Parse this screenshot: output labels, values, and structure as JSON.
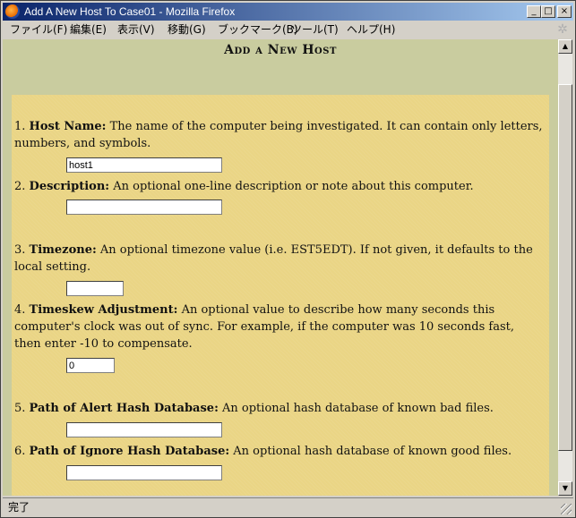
{
  "window": {
    "title": "Add A New Host To Case01 - Mozilla Firefox",
    "controls": {
      "minimize": "_",
      "maximize": "□",
      "close": "×"
    }
  },
  "menu": {
    "items": [
      "ファイル(F)",
      "編集(E)",
      "表示(V)",
      "移動(G)",
      "ブックマーク(B)",
      "ツール(T)",
      "ヘルプ(H)"
    ]
  },
  "page": {
    "heading": "Add a New Host",
    "fields": [
      {
        "number": "1.",
        "label": "Host Name:",
        "description": "The name of the computer being investigated. It can contain only letters, numbers, and symbols.",
        "value": "host1"
      },
      {
        "number": "2.",
        "label": "Description:",
        "description": "An optional one-line description or note about this computer.",
        "value": ""
      },
      {
        "number": "3.",
        "label": "Timezone:",
        "description": "An optional timezone value (i.e. EST5EDT). If not given, it defaults to the local setting.",
        "value": ""
      },
      {
        "number": "4.",
        "label": "Timeskew Adjustment:",
        "description": "An optional value to describe how many seconds this computer's clock was out of sync. For example, if the computer was 10 seconds fast, then enter -10 to compensate.",
        "value": "0"
      },
      {
        "number": "5.",
        "label": "Path of Alert Hash Database:",
        "description": "An optional hash database of known bad files.",
        "value": ""
      },
      {
        "number": "6.",
        "label": "Path of Ignore Hash Database:",
        "description": "An optional hash database of known good files.",
        "value": ""
      }
    ]
  },
  "status": {
    "text": "完了"
  },
  "icons": {
    "app": "firefox-icon",
    "throbber": "activity-throbber-icon"
  }
}
